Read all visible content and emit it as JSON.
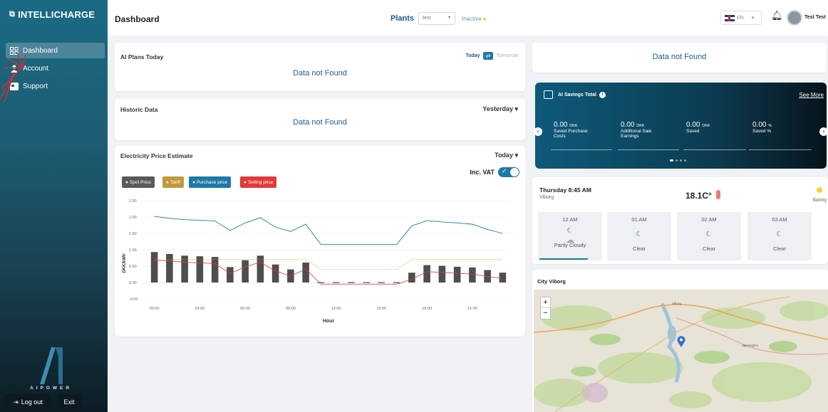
{
  "sidebar": {
    "brand": "INTELLICHARGE",
    "items": [
      {
        "label": "Dashboard",
        "icon": "grid-icon",
        "active": true
      },
      {
        "label": "Account",
        "icon": "user-icon",
        "active": false
      },
      {
        "label": "Support",
        "icon": "support-icon",
        "active": false
      }
    ],
    "logo_text": "AIPOWER",
    "logout_label": "Log out",
    "exit_label": "Exit"
  },
  "header": {
    "title": "Dashboard",
    "plants_label": "Plants",
    "plant_value": "test",
    "status": "Inactive",
    "language": "EN",
    "user_name": "Test Test"
  },
  "ai_plans": {
    "title": "AI Plans Today",
    "toggle_today": "Today",
    "toggle_tomorrow": "Tomorrow",
    "empty": "Data not Found"
  },
  "historic": {
    "title": "Historic Data",
    "period": "Yesterday",
    "empty": "Data not Found"
  },
  "top_right_card": {
    "empty": "Data not Found"
  },
  "price_card": {
    "title": "Electricity Price Estimate",
    "period": "Today",
    "vat_label": "Inc. VAT",
    "vat_enabled": true
  },
  "chart_data": {
    "type": "bar",
    "legend": [
      {
        "name": "Spot Price",
        "color": "#5a5a5a"
      },
      {
        "name": "Tariff",
        "color": "#c29a3c"
      },
      {
        "name": "Purchase price",
        "color": "#1d7aa8"
      },
      {
        "name": "Selling price",
        "color": "#e23a3a"
      }
    ],
    "xlabel": "Hour",
    "ylabel": "DKK/kWh",
    "ylim": [
      -0.5,
      2.5
    ],
    "yticks": [
      "2.50",
      "2.00",
      "1.50",
      "1.00",
      "0.50",
      "0.00",
      "-0.50"
    ],
    "xticks": [
      "00:00",
      "03:00",
      "06:00",
      "09:00",
      "12:00",
      "15:00",
      "18:00",
      "21:00"
    ],
    "hours": [
      0,
      1,
      2,
      3,
      4,
      5,
      6,
      7,
      8,
      9,
      10,
      11,
      12,
      13,
      14,
      15,
      16,
      17,
      18,
      19,
      20,
      21,
      22,
      23
    ],
    "series": [
      {
        "name": "Spot Price",
        "values": [
          0.93,
          0.87,
          0.82,
          0.8,
          0.78,
          0.47,
          0.68,
          0.82,
          0.55,
          0.4,
          0.61,
          0.01,
          0.01,
          0.01,
          0.01,
          0.01,
          0.01,
          0.3,
          0.53,
          0.51,
          0.48,
          0.46,
          0.38,
          0.3
        ]
      },
      {
        "name": "Purchase price",
        "values": [
          2.02,
          1.96,
          1.92,
          1.9,
          1.88,
          1.59,
          1.82,
          1.98,
          1.69,
          1.56,
          1.78,
          1.16,
          1.16,
          1.16,
          1.16,
          1.16,
          1.16,
          1.73,
          1.89,
          1.85,
          1.82,
          1.78,
          1.62,
          1.5
        ]
      },
      {
        "name": "Tariff",
        "values": [
          0.7,
          0.7,
          0.7,
          0.7,
          0.7,
          0.7,
          0.7,
          0.7,
          0.7,
          0.7,
          0.7,
          0.4,
          0.4,
          0.4,
          0.4,
          0.4,
          0.4,
          0.7,
          0.7,
          0.7,
          0.7,
          0.7,
          0.7,
          0.7
        ]
      },
      {
        "name": "Selling price",
        "values": [
          0.68,
          0.66,
          0.62,
          0.6,
          0.58,
          0.27,
          0.48,
          0.62,
          0.35,
          0.2,
          0.41,
          -0.05,
          -0.05,
          -0.05,
          -0.05,
          -0.05,
          -0.05,
          0.1,
          0.33,
          0.31,
          0.28,
          0.26,
          0.18,
          0.12
        ]
      }
    ]
  },
  "savings": {
    "title": "AI Savings Total",
    "see_more": "See More",
    "items": [
      {
        "value": "0.00",
        "unit": "DKK",
        "label": "Saved Purchase Costs"
      },
      {
        "value": "0.00",
        "unit": "DKK",
        "label": "Additional Sale Earnings"
      },
      {
        "value": "0.00",
        "unit": "DKK",
        "label": "Saved"
      },
      {
        "value": "0.00",
        "unit": "%",
        "label": "Saved %"
      }
    ]
  },
  "weather": {
    "datetime": "Thursday 8:45 AM",
    "location": "Viborg",
    "temperature": "18.1C°",
    "condition": "Sunny",
    "hours": [
      {
        "time": "12 AM",
        "label": "Partly Cloudy"
      },
      {
        "time": "01 AM",
        "label": "Clear"
      },
      {
        "time": "02 AM",
        "label": "Clear"
      },
      {
        "time": "03 AM",
        "label": "Clear"
      }
    ]
  },
  "map": {
    "title": "City Viborg",
    "zoom_in": "+",
    "zoom_out": "−",
    "place_labels": [
      "Viborg",
      "Bjerringbro"
    ]
  }
}
